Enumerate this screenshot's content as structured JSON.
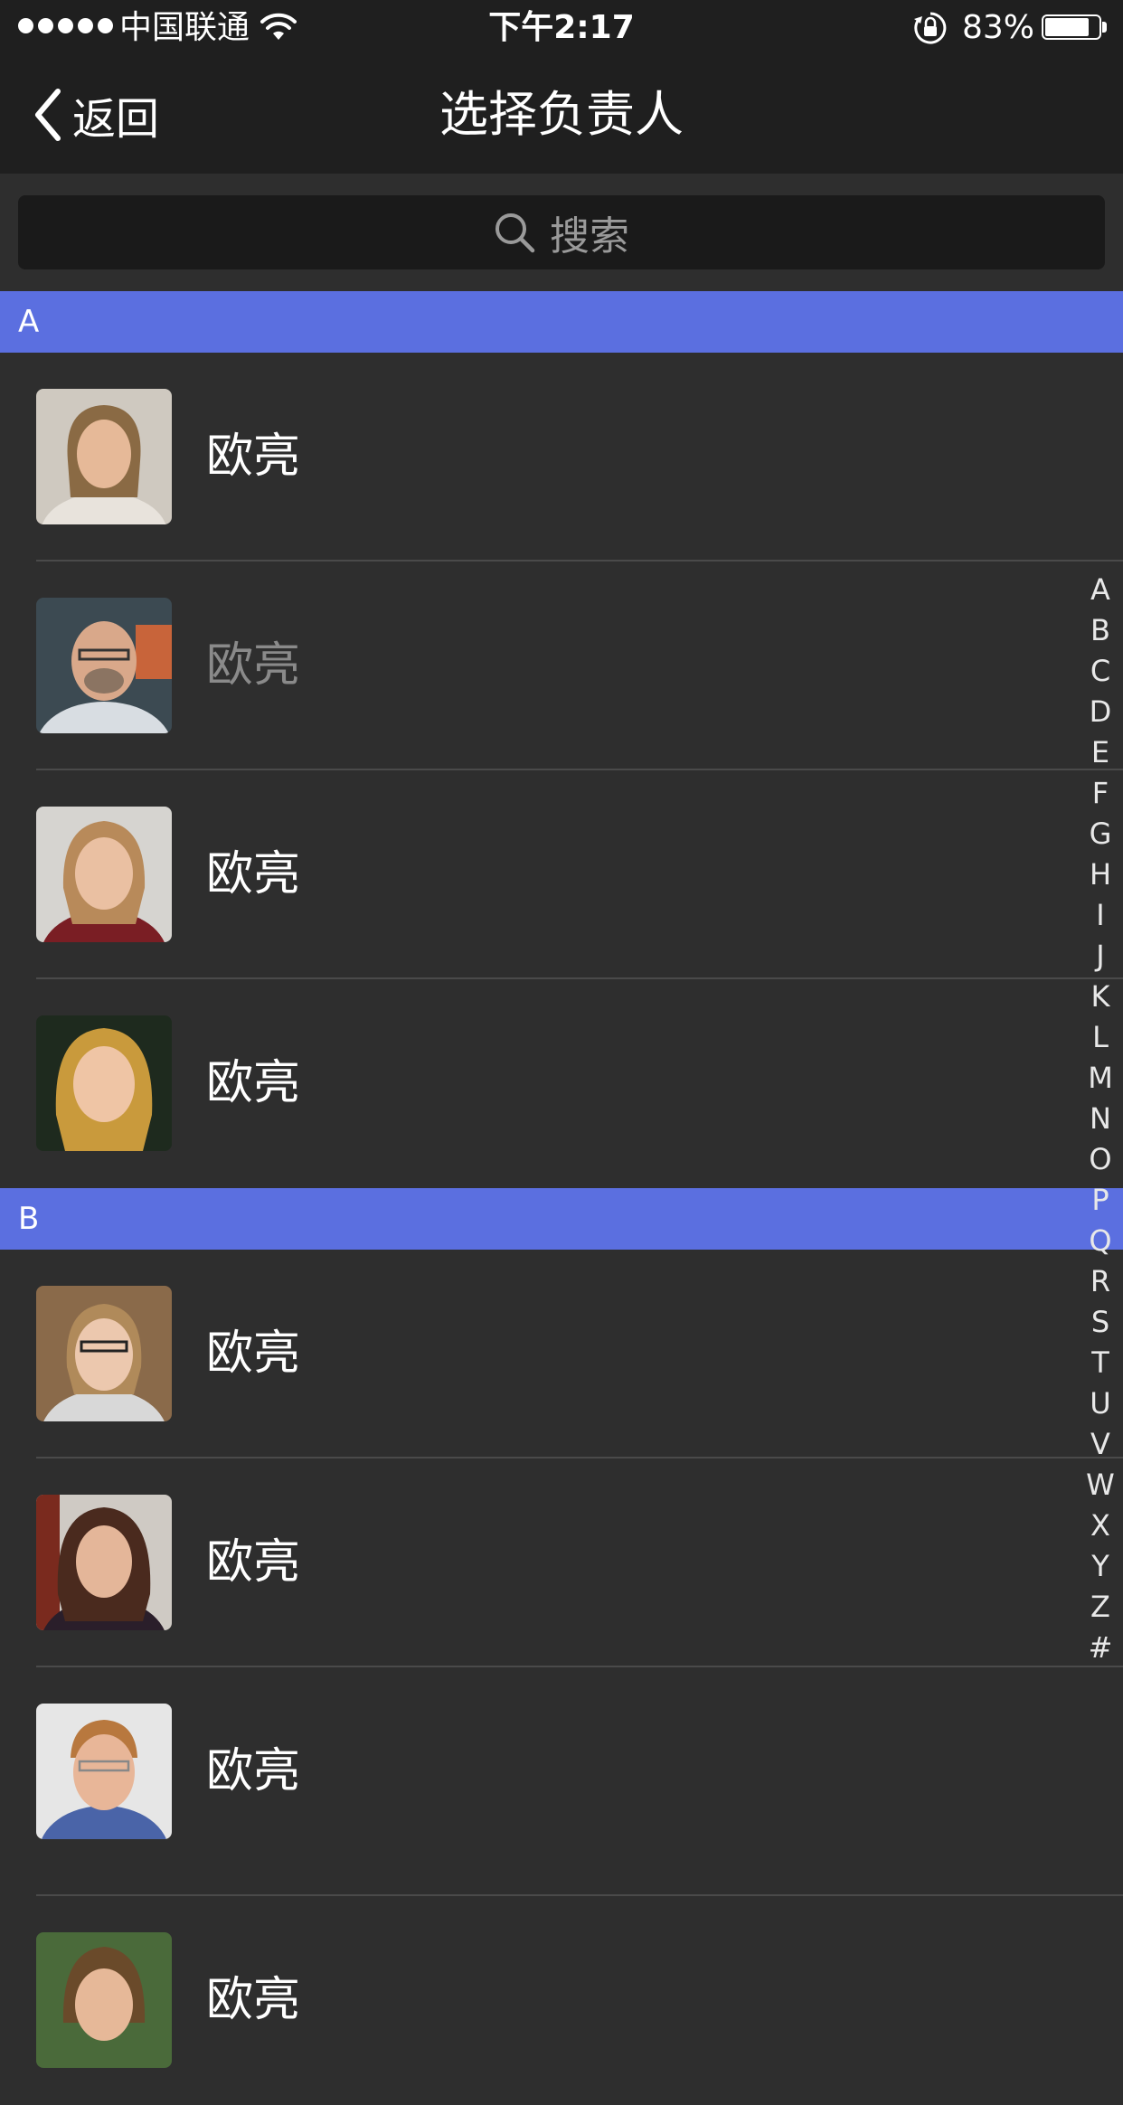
{
  "status_bar": {
    "carrier": "中国联通",
    "time": "下午2:17",
    "battery_percent": "83%",
    "battery_level": 0.83,
    "icons": [
      "signal-dots-icon",
      "wifi-icon",
      "rotation-lock-icon",
      "battery-icon"
    ]
  },
  "nav": {
    "back_label": "返回",
    "title": "选择负责人"
  },
  "search": {
    "placeholder": "搜索"
  },
  "sections": [
    {
      "letter": "A",
      "contacts": [
        {
          "name": "欧亮",
          "dimmed": false
        },
        {
          "name": "欧亮",
          "dimmed": true
        },
        {
          "name": "欧亮",
          "dimmed": false
        },
        {
          "name": "欧亮",
          "dimmed": false
        }
      ]
    },
    {
      "letter": "B",
      "contacts": [
        {
          "name": "欧亮",
          "dimmed": false
        },
        {
          "name": "欧亮",
          "dimmed": false
        },
        {
          "name": "欧亮",
          "dimmed": false
        },
        {
          "name": "欧亮",
          "dimmed": false
        }
      ]
    }
  ],
  "index_letters": [
    "A",
    "B",
    "C",
    "D",
    "E",
    "F",
    "G",
    "H",
    "I",
    "J",
    "K",
    "L",
    "M",
    "N",
    "O",
    "P",
    "Q",
    "R",
    "S",
    "T",
    "U",
    "V",
    "W",
    "X",
    "Y",
    "Z",
    "#"
  ],
  "colors": {
    "background": "#2e2e2e",
    "bar_background": "#1f1f1f",
    "section_header": "#5b6fe0",
    "search_field": "#1a1a1a",
    "dimmed_text": "#8a8a8a"
  }
}
